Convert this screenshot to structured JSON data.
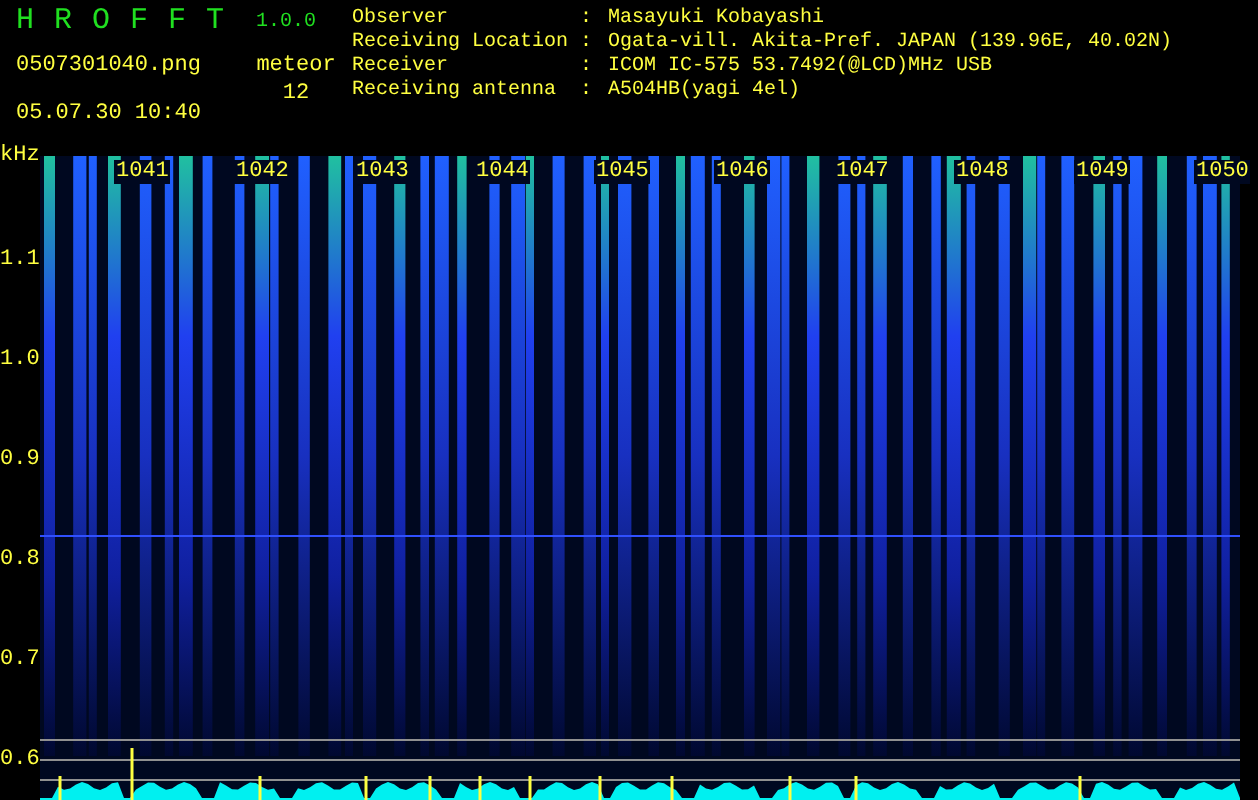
{
  "app": {
    "name": "HROFFT",
    "version": "1.0.0"
  },
  "file": "0507301040.png",
  "datetime": "05.07.30 10:40",
  "meteor": {
    "label": "meteor",
    "count": "12"
  },
  "info": [
    {
      "label": "Observer",
      "colon": ":",
      "value": "Masayuki Kobayashi"
    },
    {
      "label": "Receiving Location",
      "colon": ":",
      "value": "Ogata-vill. Akita-Pref. JAPAN (139.96E, 40.02N)"
    },
    {
      "label": "Receiver",
      "colon": ":",
      "value": "ICOM IC-575 53.7492(@LCD)MHz USB"
    },
    {
      "label": "Receiving antenna",
      "colon": ":",
      "value": "A504HB(yagi 4el)"
    }
  ],
  "spectrogram": {
    "unit": "kHz",
    "y_labels": [
      "1.1",
      "1.0",
      "0.9",
      "0.8",
      "0.7",
      "0.6"
    ],
    "x_labels": [
      "1041",
      "1042",
      "1043",
      "1044",
      "1045",
      "1046",
      "1047",
      "1048",
      "1049",
      "1050"
    ]
  }
}
